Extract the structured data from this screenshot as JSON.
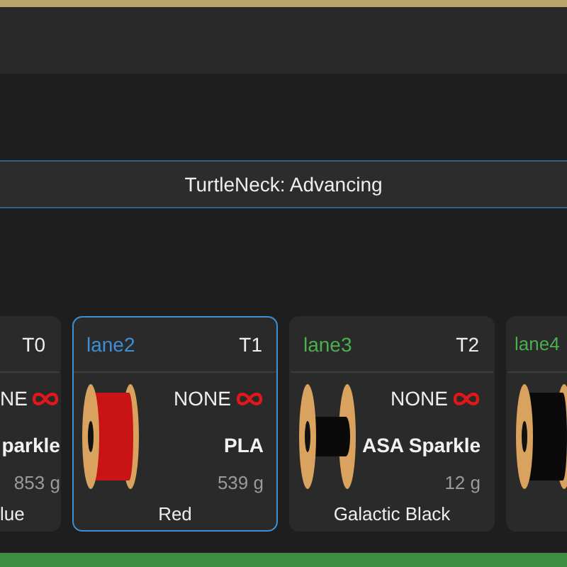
{
  "banner": {
    "text": "TurtleNeck: Advancing"
  },
  "lanes": [
    {
      "kind": "cut_left",
      "selected": false,
      "tool": "T0",
      "status": "NE",
      "material": "parkle",
      "weight": "853 g",
      "color_name": "lue"
    },
    {
      "kind": "full",
      "selected": true,
      "name": "lane2",
      "color": "#3d8fd6",
      "tool": "T1",
      "status": "NONE",
      "spool": {
        "kind": "full",
        "color": "#c81414"
      },
      "material": "PLA",
      "weight": "539 g",
      "color_name": "Red"
    },
    {
      "kind": "full",
      "selected": false,
      "name": "lane3",
      "color": "#4caf50",
      "tool": "T2",
      "status": "NONE",
      "spool": {
        "kind": "low",
        "color": "#0a0a0a"
      },
      "material": "ASA Sparkle",
      "weight": "12 g",
      "color_name": "Galactic Black"
    },
    {
      "kind": "cut_right",
      "selected": false,
      "name": "lane4",
      "color": "#4caf50",
      "spool": {
        "kind": "full",
        "color": "#0a0a0a"
      }
    }
  ]
}
